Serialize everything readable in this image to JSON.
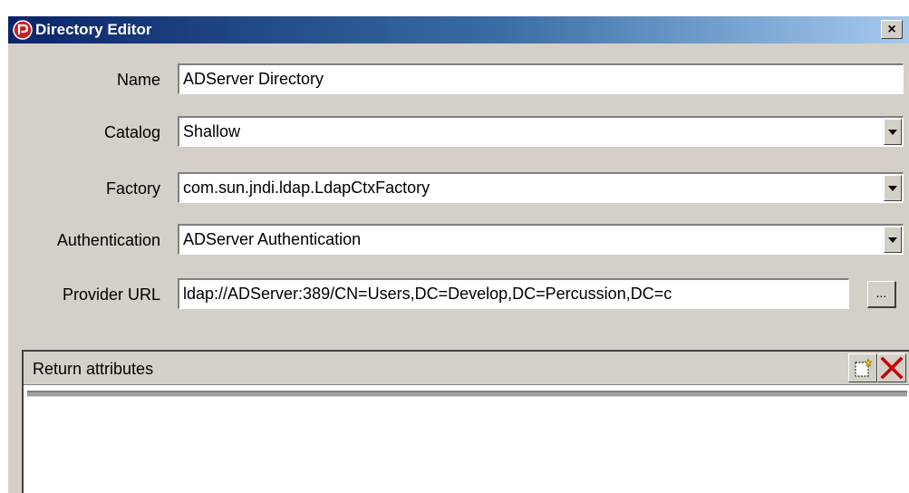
{
  "window": {
    "title": "Directory Editor",
    "close_label": "×",
    "app_icon": "percussion-logo-icon"
  },
  "form": {
    "name": {
      "label": "Name",
      "value": "ADServer Directory"
    },
    "catalog": {
      "label": "Catalog",
      "value": "Shallow"
    },
    "factory": {
      "label": "Factory",
      "value": "com.sun.jndi.ldap.LdapCtxFactory"
    },
    "authentication": {
      "label": "Authentication",
      "value": "ADServer Authentication"
    },
    "provider_url": {
      "label": "Provider URL",
      "value": "ldap://ADServer:389/CN=Users,DC=Develop,DC=Percussion,DC=c",
      "browse_label": "..."
    }
  },
  "return_attributes": {
    "header": "Return attributes",
    "add_icon": "new-row-icon",
    "delete_icon": "delete-x-icon",
    "rows": []
  },
  "colors": {
    "titlebar_start": "#0a246a",
    "titlebar_end": "#a6caf0",
    "dialog_bg": "#d4d0c8",
    "delete_red": "#cc0000"
  }
}
